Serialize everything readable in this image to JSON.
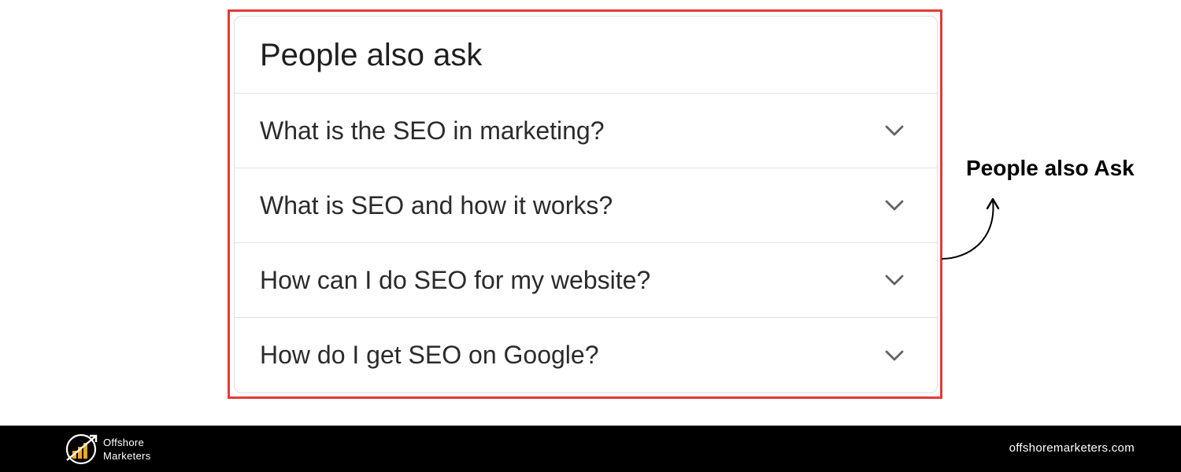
{
  "paa": {
    "title": "People also ask",
    "questions": [
      "What is the SEO in marketing?",
      "What is SEO and how it works?",
      "How can I do SEO for my website?",
      "How do I get SEO on Google?"
    ]
  },
  "annotation": {
    "label": "People also Ask"
  },
  "footer": {
    "brand_line1": "Offshore",
    "brand_line2": "Marketers",
    "url": "offshoremarketers.com"
  },
  "colors": {
    "highlight_border": "#e53935",
    "footer_background": "#000000",
    "logo_accent": "#f5a623"
  },
  "icons": {
    "row_expand": "chevron-down-icon",
    "annotation": "curved-arrow-icon",
    "brand": "offshore-marketers-logo"
  }
}
